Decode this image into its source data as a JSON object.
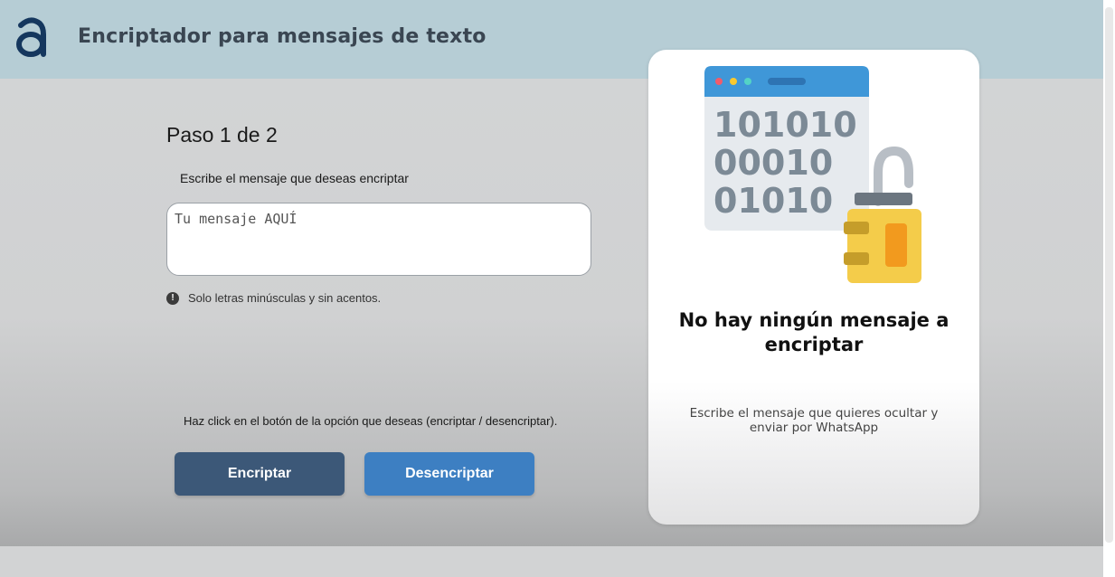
{
  "header": {
    "title": "Encriptador para mensajes de texto",
    "logo_icon": "letter-a-logo",
    "logo_color": "#15375e"
  },
  "main": {
    "step_title": "Paso 1 de 2",
    "input_instruction": "Escribe el mensaje que deseas encriptar",
    "message_input": {
      "value": "",
      "placeholder": "Tu mensaje AQUÍ"
    },
    "hint_icon": "exclamation-icon",
    "hint": "Solo letras minúsculas y sin acentos.",
    "click_instruction": "Haz click en el botón de la opción que deseas (encriptar / desencriptar).",
    "encrypt_label": "Encriptar",
    "decrypt_label": "Desencriptar"
  },
  "result_panel": {
    "illustration_icon": "encrypted-window-lock-icon",
    "binary_lines": [
      "101010",
      "00010",
      "01010"
    ],
    "title": "No hay ningún mensaje a encriptar",
    "subtitle": "Escribe el mensaje que quieres ocultar y enviar por WhatsApp"
  },
  "colors": {
    "header_bg": "#b6cdd5",
    "encrypt_button": "#3c5878",
    "decrypt_button": "#3d7fc2"
  }
}
